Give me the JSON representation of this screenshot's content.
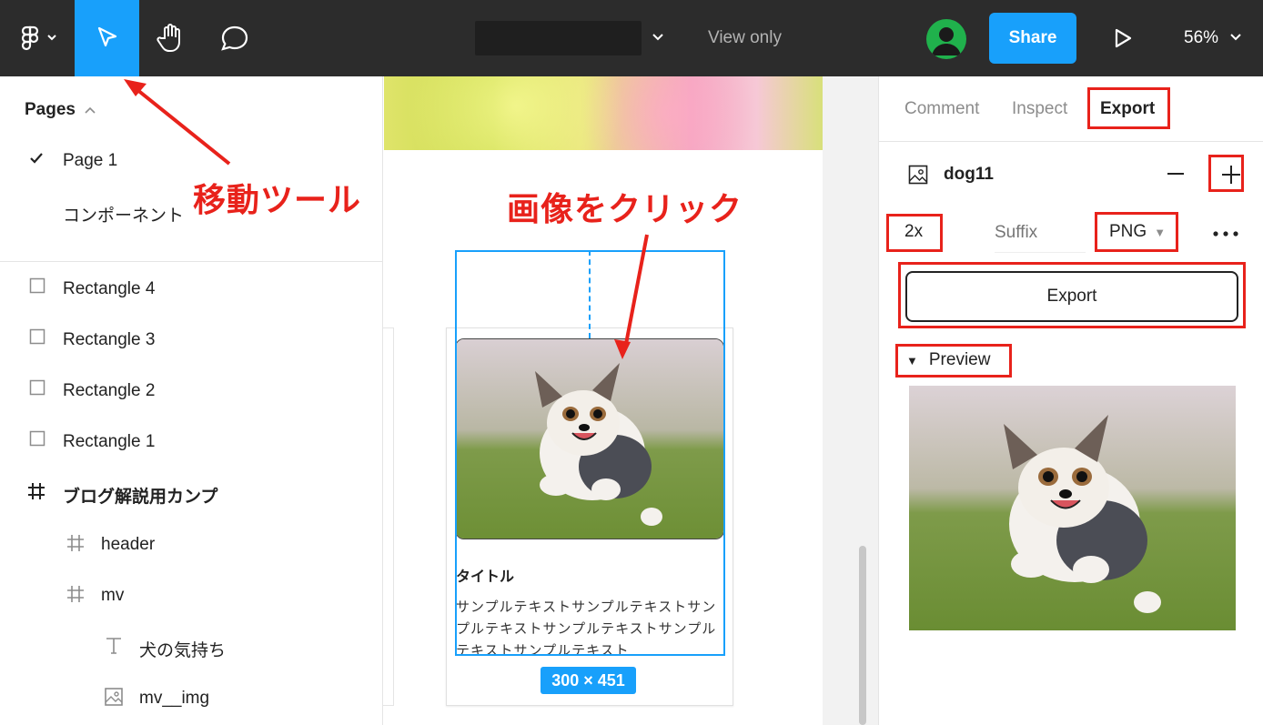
{
  "toolbar": {
    "view_mode": "View only",
    "share_label": "Share",
    "zoom": "56%",
    "icons": [
      "figma-menu-icon",
      "move-tool-icon",
      "hand-tool-icon",
      "comment-icon",
      "play-icon"
    ]
  },
  "pages": {
    "title": "Pages",
    "items": [
      {
        "label": "Page 1",
        "checked": true
      },
      {
        "label": "コンポーネント",
        "checked": false
      }
    ]
  },
  "layers": [
    {
      "label": "Rectangle 4",
      "icon": "rectangle-icon"
    },
    {
      "label": "Rectangle 3",
      "icon": "rectangle-icon"
    },
    {
      "label": "Rectangle 2",
      "icon": "rectangle-icon"
    },
    {
      "label": "Rectangle 1",
      "icon": "rectangle-icon"
    },
    {
      "label": "ブログ解説用カンプ",
      "icon": "frame-icon"
    },
    {
      "label": "header",
      "icon": "frame-icon"
    },
    {
      "label": "mv",
      "icon": "frame-icon"
    },
    {
      "label": "犬の気持ち",
      "icon": "text-icon"
    },
    {
      "label": "mv__img",
      "icon": "image-icon"
    }
  ],
  "canvas": {
    "card_title": "タイトル",
    "card_text": "サンプルテキストサンプルテキストサンプルテキストサンプルテキストサンプルテキストサンプルテキスト",
    "size_badge": "300 × 451"
  },
  "right_panel": {
    "tabs": [
      "Comment",
      "Inspect",
      "Export"
    ],
    "active_tab": "Export",
    "asset_name": "dog11",
    "scale": "2x",
    "suffix_placeholder": "Suffix",
    "format": "PNG",
    "export_label": "Export",
    "preview_label": "Preview"
  },
  "annotations": {
    "move_tool": "移動ツール",
    "click_image": "画像をクリック"
  },
  "colors": {
    "accent": "#18a0fb",
    "toolbar_bg": "#2c2c2c",
    "annotation_red": "#e8221b",
    "avatar_green": "#20b14c"
  }
}
